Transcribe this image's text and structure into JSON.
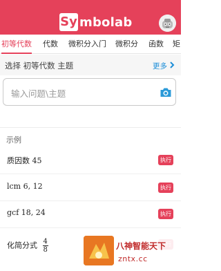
{
  "header": {
    "logo_box": "Sy",
    "logo_rest": "mbolab",
    "avatar_icon": "robot-avatar-icon",
    "bg_color": "#e5415a"
  },
  "tabs": [
    {
      "label": "初等代数",
      "active": true
    },
    {
      "label": "代数",
      "active": false
    },
    {
      "label": "微积分入门",
      "active": false
    },
    {
      "label": "微积分",
      "active": false
    },
    {
      "label": "函数",
      "active": false
    },
    {
      "label": "矩",
      "active": false
    }
  ],
  "section": {
    "title": "选择 初等代数 主题",
    "more_label": "更多",
    "more_icon": "chevron-right-icon"
  },
  "search": {
    "placeholder": "输入问题\\主题",
    "camera_icon": "camera-icon"
  },
  "examples": {
    "title": "示例",
    "exec_label": "执行",
    "items": [
      {
        "text": "质因数 45"
      },
      {
        "text": "lcm 6, 12"
      },
      {
        "text": "gcf 18, 24"
      },
      {
        "text": "化简分式",
        "frac_num": "4",
        "frac_den": "8"
      }
    ]
  },
  "watermark": {
    "title": "八神智能天下",
    "url": "zntx.cc"
  },
  "colors": {
    "accent": "#e5415a",
    "link": "#1d8ed8"
  }
}
